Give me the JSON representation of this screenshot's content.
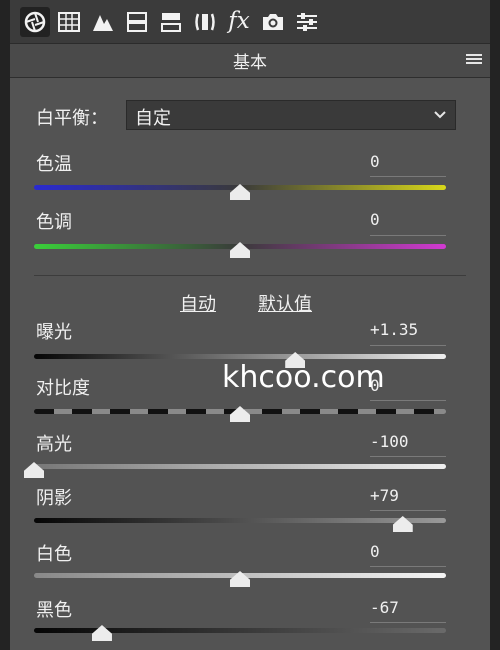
{
  "toolbar": {
    "tools": [
      "basic-aperture-icon",
      "tone-curve-grid-icon",
      "detail-mountain-icon",
      "hsl-icon",
      "split-toning-icon",
      "lens-icon",
      "fx-icon",
      "camera-calibration-icon",
      "presets-sliders-icon"
    ],
    "fx_label": "fx"
  },
  "panel": {
    "title": "基本"
  },
  "white_balance": {
    "label": "白平衡：",
    "value": "自定"
  },
  "sliders": {
    "temperature": {
      "label": "色温",
      "value": "0",
      "level": 0.5
    },
    "tint": {
      "label": "色调",
      "value": "0",
      "level": 0.5
    },
    "exposure": {
      "label": "曝光",
      "value": "+1.35",
      "level": 0.634
    },
    "contrast": {
      "label": "对比度",
      "value": "0",
      "level": 0.5
    },
    "highlights": {
      "label": "高光",
      "value": "-100",
      "level": 0.0
    },
    "shadows": {
      "label": "阴影",
      "value": "+79",
      "level": 0.895
    },
    "whites": {
      "label": "白色",
      "value": "0",
      "level": 0.5
    },
    "blacks": {
      "label": "黑色",
      "value": "-67",
      "level": 0.165
    }
  },
  "auto_label": "自动",
  "default_label": "默认值",
  "watermark": "khcoo.com",
  "colors": {
    "temperature_left": "#2a2ad0",
    "temperature_right": "#d8d81a",
    "tint_left": "#3ad03a",
    "tint_right": "#d23ad2"
  }
}
